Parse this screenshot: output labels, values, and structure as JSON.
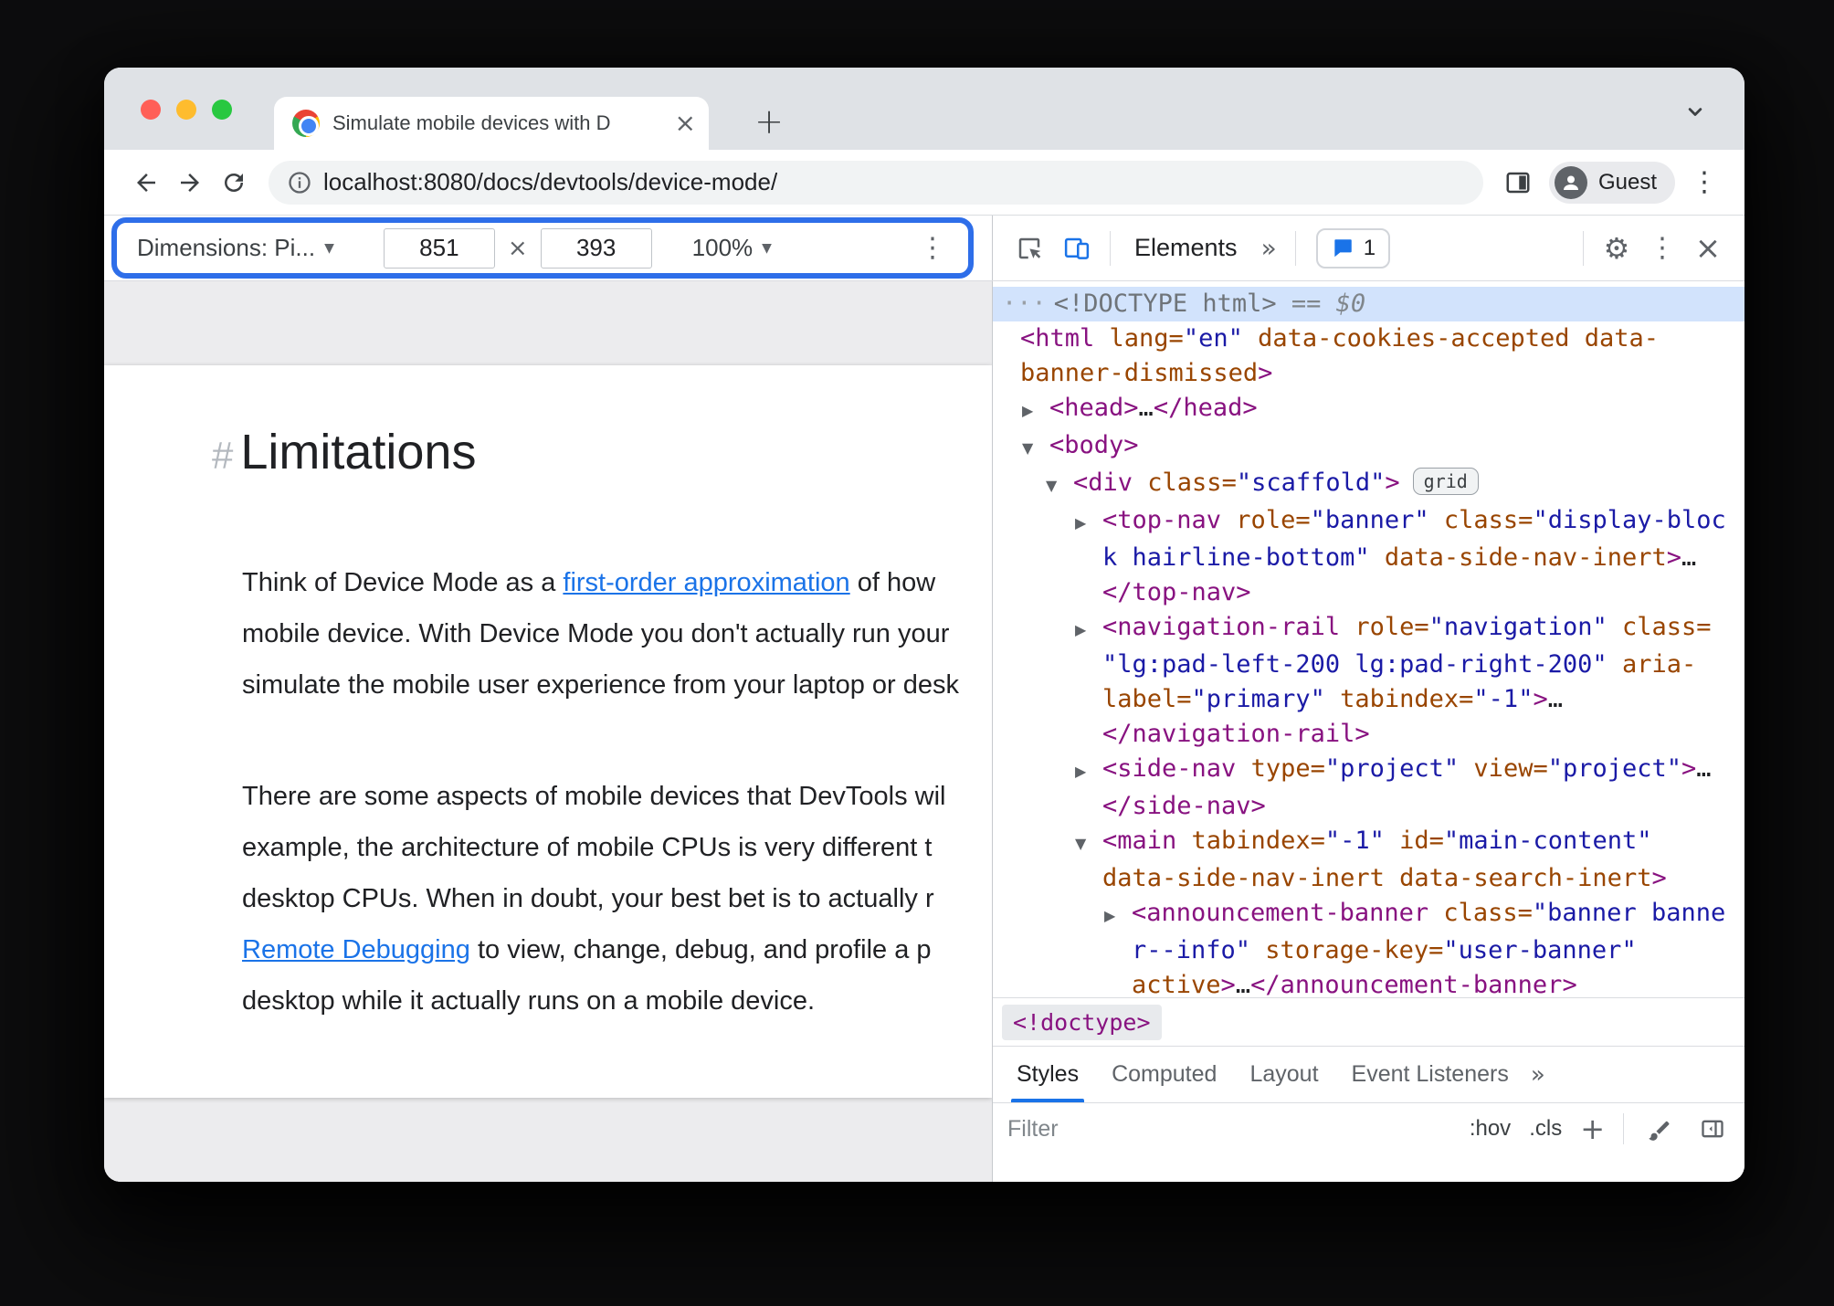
{
  "browser": {
    "tab_title": "Simulate mobile devices with D",
    "url": "localhost:8080/docs/devtools/device-mode/",
    "guest_label": "Guest"
  },
  "device_toolbar": {
    "dimensions_label": "Dimensions: Pi...",
    "width_value": "851",
    "height_value": "393",
    "zoom_value": "100%"
  },
  "devtools": {
    "elements_tab": "Elements",
    "issues_count": "1",
    "breadcrumb": "<!doctype>",
    "sidebar_tabs": [
      "Styles",
      "Computed",
      "Layout",
      "Event Listeners"
    ],
    "filter_placeholder": "Filter",
    "hov_label": ":hov",
    "cls_label": ".cls",
    "dom_lines": [
      {
        "lvl": 0,
        "sel": true,
        "segs": [
          {
            "c": "dots",
            "t": "···"
          },
          {
            "c": "doctype",
            "t": "<!DOCTYPE html>"
          },
          {
            "c": "eq",
            "t": " == $0"
          }
        ]
      },
      {
        "lvl": 1,
        "segs": [
          {
            "c": "tag",
            "t": "<html"
          },
          {
            "c": "attr",
            "t": " lang="
          },
          {
            "c": "val",
            "t": "\"en\""
          },
          {
            "c": "attr",
            "t": " data-cookies-accepted data-"
          }
        ]
      },
      {
        "lvl": 1,
        "segs": [
          {
            "c": "attr",
            "t": "banner-dismissed"
          },
          {
            "c": "tag",
            "t": ">"
          }
        ]
      },
      {
        "lvl": 2,
        "arrow": "closed",
        "segs": [
          {
            "c": "tag",
            "t": "<head>"
          },
          {
            "c": "ellipsis",
            "t": "…"
          },
          {
            "c": "tag",
            "t": "</head>"
          }
        ]
      },
      {
        "lvl": 2,
        "arrow": "open",
        "segs": [
          {
            "c": "tag",
            "t": "<body>"
          }
        ]
      },
      {
        "lvl": 3,
        "arrow": "open",
        "segs": [
          {
            "c": "tag",
            "t": "<div"
          },
          {
            "c": "attr",
            "t": " class="
          },
          {
            "c": "val",
            "t": "\"scaffold\""
          },
          {
            "c": "tag",
            "t": ">"
          },
          {
            "c": "badge",
            "t": "grid"
          }
        ]
      },
      {
        "lvl": 4,
        "arrow": "closed",
        "segs": [
          {
            "c": "tag",
            "t": "<top-nav"
          },
          {
            "c": "attr",
            "t": " role="
          },
          {
            "c": "val",
            "t": "\"banner\""
          },
          {
            "c": "attr",
            "t": " class="
          },
          {
            "c": "val",
            "t": "\"display-bloc"
          }
        ]
      },
      {
        "lvl": 4,
        "segs": [
          {
            "c": "val",
            "t": "k hairline-bottom\""
          },
          {
            "c": "attr",
            "t": " data-side-nav-inert"
          },
          {
            "c": "tag",
            "t": ">"
          },
          {
            "c": "ellipsis",
            "t": "…"
          }
        ]
      },
      {
        "lvl": 4,
        "segs": [
          {
            "c": "tag",
            "t": "</top-nav>"
          }
        ]
      },
      {
        "lvl": 4,
        "arrow": "closed",
        "segs": [
          {
            "c": "tag",
            "t": "<navigation-rail"
          },
          {
            "c": "attr",
            "t": " role="
          },
          {
            "c": "val",
            "t": "\"navigation\""
          },
          {
            "c": "attr",
            "t": " class="
          }
        ]
      },
      {
        "lvl": 4,
        "segs": [
          {
            "c": "val",
            "t": "\"lg:pad-left-200 lg:pad-right-200\""
          },
          {
            "c": "attr",
            "t": " aria-"
          }
        ]
      },
      {
        "lvl": 4,
        "segs": [
          {
            "c": "attr",
            "t": "label="
          },
          {
            "c": "val",
            "t": "\"primary\""
          },
          {
            "c": "attr",
            "t": " tabindex="
          },
          {
            "c": "val",
            "t": "\"-1\""
          },
          {
            "c": "tag",
            "t": ">"
          },
          {
            "c": "ellipsis",
            "t": "…"
          }
        ]
      },
      {
        "lvl": 4,
        "segs": [
          {
            "c": "tag",
            "t": "</navigation-rail>"
          }
        ]
      },
      {
        "lvl": 4,
        "arrow": "closed",
        "segs": [
          {
            "c": "tag",
            "t": "<side-nav"
          },
          {
            "c": "attr",
            "t": " type="
          },
          {
            "c": "val",
            "t": "\"project\""
          },
          {
            "c": "attr",
            "t": " view="
          },
          {
            "c": "val",
            "t": "\"project\""
          },
          {
            "c": "tag",
            "t": ">"
          },
          {
            "c": "ellipsis",
            "t": "…"
          }
        ]
      },
      {
        "lvl": 4,
        "segs": [
          {
            "c": "tag",
            "t": "</side-nav>"
          }
        ]
      },
      {
        "lvl": 4,
        "arrow": "open",
        "segs": [
          {
            "c": "tag",
            "t": "<main"
          },
          {
            "c": "attr",
            "t": " tabindex="
          },
          {
            "c": "val",
            "t": "\"-1\""
          },
          {
            "c": "attr",
            "t": " id="
          },
          {
            "c": "val",
            "t": "\"main-content\""
          }
        ]
      },
      {
        "lvl": 4,
        "segs": [
          {
            "c": "attr",
            "t": "data-side-nav-inert data-search-inert"
          },
          {
            "c": "tag",
            "t": ">"
          }
        ]
      },
      {
        "lvl": 5,
        "arrow": "closed",
        "segs": [
          {
            "c": "tag",
            "t": "<announcement-banner"
          },
          {
            "c": "attr",
            "t": " class="
          },
          {
            "c": "val",
            "t": "\"banner banne"
          }
        ]
      },
      {
        "lvl": 5,
        "segs": [
          {
            "c": "val",
            "t": "r--info\""
          },
          {
            "c": "attr",
            "t": " storage-key="
          },
          {
            "c": "val",
            "t": "\"user-banner\""
          }
        ]
      },
      {
        "lvl": 5,
        "segs": [
          {
            "c": "attr",
            "t": "active"
          },
          {
            "c": "tag",
            "t": ">"
          },
          {
            "c": "ellipsis",
            "t": "…"
          },
          {
            "c": "tag",
            "t": "</announcement-banner>"
          }
        ]
      }
    ]
  },
  "page": {
    "heading_hash": "#",
    "heading": "Limitations",
    "para1_lines": [
      [
        {
          "t": "Think of Device Mode as a "
        },
        {
          "t": "first-order approximation",
          "link": true
        },
        {
          "t": " of how"
        }
      ],
      [
        {
          "t": "mobile device. With Device Mode you don't actually run your"
        }
      ],
      [
        {
          "t": "simulate the mobile user experience from your laptop or desk"
        }
      ]
    ],
    "para2_lines": [
      [
        {
          "t": "There are some aspects of mobile devices that DevTools wil"
        }
      ],
      [
        {
          "t": "example, the architecture of mobile CPUs is very different t"
        }
      ],
      [
        {
          "t": "desktop CPUs. When in doubt, your best bet is to actually r"
        }
      ],
      [
        {
          "t": "Remote Debugging",
          "link": true
        },
        {
          "t": " to view, change, debug, and profile a p"
        }
      ],
      [
        {
          "t": "desktop while it actually runs on a mobile device."
        }
      ]
    ]
  },
  "icons": {
    "menu_dots": "⋮",
    "gear": "⚙",
    "close": "×",
    "tab_close": "×",
    "more_tabs": "»",
    "more_panels": "»",
    "caret_down": "▼",
    "plus_tab": "+",
    "plus_filter": "+",
    "times": "×"
  },
  "colors": {
    "accent_blue": "#1a73e8",
    "highlight_ring": "#2e6ee9",
    "traffic_red": "#ff5f57",
    "traffic_yellow": "#febc2e",
    "traffic_green": "#28c840",
    "dom_tag": "#881280",
    "dom_attr": "#994500",
    "dom_value": "#1a1aa6",
    "selection_bg": "#d2e3fc"
  }
}
